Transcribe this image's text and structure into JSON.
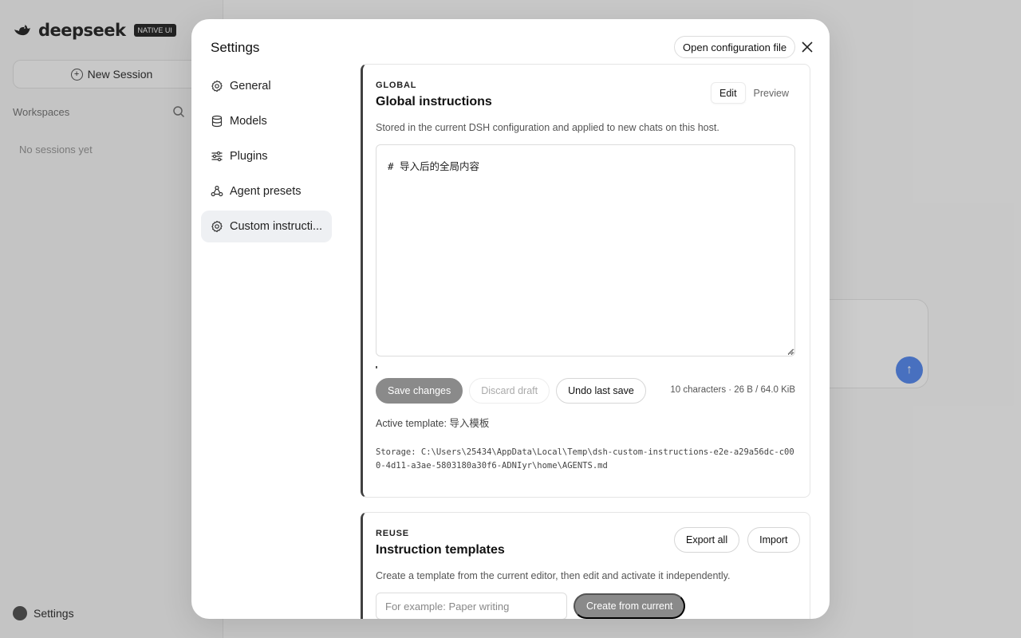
{
  "app": {
    "brand": "deepseek",
    "brand_badge": "NATIVE UI",
    "new_session_label": "New Session",
    "workspaces_label": "Workspaces",
    "empty_sessions": "No sessions yet",
    "settings_label": "Settings"
  },
  "modal": {
    "title": "Settings",
    "open_config_label": "Open configuration file",
    "close_icon": "close-icon",
    "nav": [
      {
        "label": "General",
        "icon": "gear-icon",
        "active": false
      },
      {
        "label": "Models",
        "icon": "database-icon",
        "active": false
      },
      {
        "label": "Plugins",
        "icon": "sliders-icon",
        "active": false
      },
      {
        "label": "Agent presets",
        "icon": "agent-icon",
        "active": false
      },
      {
        "label": "Custom instructi...",
        "icon": "gear-icon",
        "active": true
      }
    ],
    "global": {
      "eyebrow": "GLOBAL",
      "title": "Global instructions",
      "tabs": {
        "edit": "Edit",
        "preview": "Preview",
        "selected": "Edit"
      },
      "description": "Stored in the current DSH configuration and applied to new chats on this host.",
      "editor_value": "# 导入后的全局内容",
      "save_label": "Save changes",
      "discard_label": "Discard draft",
      "undo_label": "Undo last save",
      "counter": "10 characters · 26 B / 64.0 KiB",
      "active_template": "Active template: 导入模板",
      "storage": "Storage: C:\\Users\\25434\\AppData\\Local\\Temp\\dsh-custom-instructions-e2e-a29a56dc-c000-4d11-a3ae-5803180a30f6-ADNIyr\\home\\AGENTS.md"
    },
    "reuse": {
      "eyebrow": "REUSE",
      "title": "Instruction templates",
      "export_label": "Export all",
      "import_label": "Import",
      "description": "Create a template from the current editor, then edit and activate it independently.",
      "name_placeholder": "For example: Paper writing",
      "create_label": "Create from current"
    }
  },
  "colors": {
    "overlay": "rgba(0,0,0,0.2)",
    "accent_bar": "#404040",
    "primary_button": "#8a8a8a",
    "send_button": "#5b8def"
  }
}
